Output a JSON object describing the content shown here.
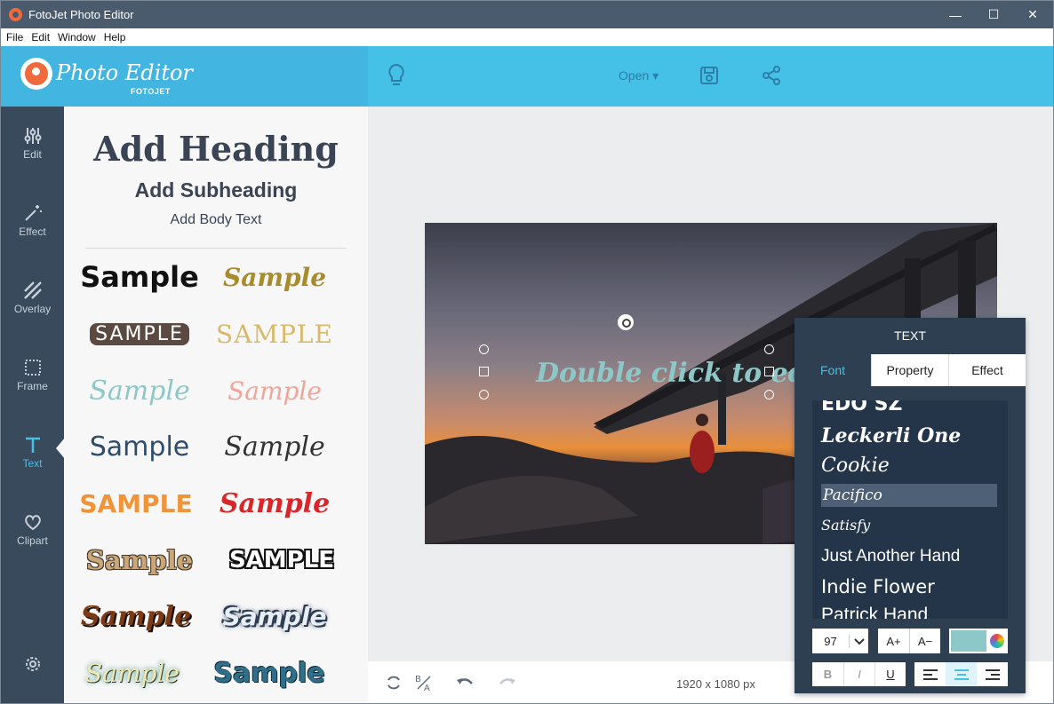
{
  "window": {
    "title": "FotoJet Photo Editor",
    "minimize_glyph": "—",
    "maximize_glyph": "☐",
    "close_glyph": "✕"
  },
  "menu": [
    "File",
    "Edit",
    "Window",
    "Help"
  ],
  "brand": {
    "name": "Photo Editor",
    "sub": "FOTOJET"
  },
  "toolbar": {
    "open_label": "Open ▾",
    "icons": [
      "lightbulb-icon",
      "save-icon",
      "share-icon"
    ]
  },
  "nav": [
    {
      "label": "Edit",
      "icon": "sliders-icon"
    },
    {
      "label": "Effect",
      "icon": "magic-wand-icon"
    },
    {
      "label": "Overlay",
      "icon": "stripes-icon"
    },
    {
      "label": "Frame",
      "icon": "frame-icon"
    },
    {
      "label": "Text",
      "icon": "text-icon"
    },
    {
      "label": "Clipart",
      "icon": "heart-icon"
    }
  ],
  "text_panel": {
    "heading": "Add Heading",
    "subheading": "Add Subheading",
    "body": "Add Body Text",
    "samples": [
      "Sample",
      "Sample",
      "SAMPLE",
      "SAMPLE",
      "Sample",
      "Sample",
      "Sample",
      "Sample",
      "SAMPLE",
      "Sample",
      "Sample",
      "SAMPLE",
      "Sample",
      "Sample",
      "Sample",
      "Sample"
    ]
  },
  "canvas": {
    "placeholder_text": "Double click to edit",
    "dimensions": "1920 x 1080 px"
  },
  "text_popup": {
    "title": "TEXT",
    "tabs": [
      "Font",
      "Property",
      "Effect"
    ],
    "active_tab": "Font",
    "fonts": [
      "EDO SZ",
      "Leckerli One",
      "Cookie",
      "Pacifico",
      "Satisfy",
      "Just Another Hand",
      "Indie Flower",
      "Patrick Hand"
    ],
    "selected_font": "Pacifico",
    "font_size": "97",
    "increase_label": "A+",
    "decrease_label": "A−",
    "bold_label": "B",
    "italic_label": "I",
    "underline_label": "U",
    "text_color": "#8ec7c8",
    "active_align": "center"
  },
  "colors": {
    "accent": "#45c0e6",
    "sidebar": "#394a5c",
    "titlebar": "#4a5b6e"
  }
}
